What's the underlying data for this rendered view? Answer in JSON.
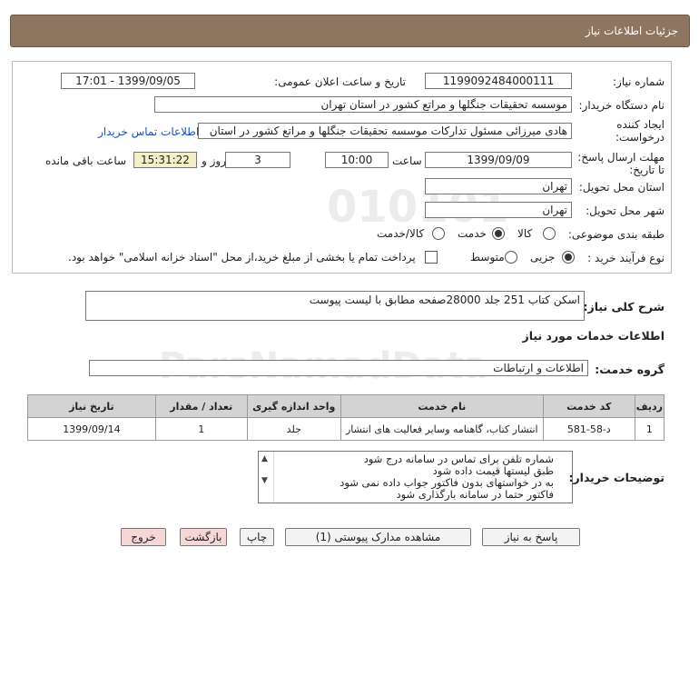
{
  "header": {
    "title": "جزئیات اطلاعات نیاز"
  },
  "need": {
    "number_label": "شماره نیاز:",
    "number_value": "1199092484000111",
    "announce_label": "تاریخ و ساعت اعلان عمومی:",
    "announce_value": "1399/09/05 - 17:01",
    "buyer_label": "نام دستگاه خریدار:",
    "buyer_value": "موسسه تحقیقات جنگلها و مراتع کشور در استان تهران",
    "creator_label": "ایجاد کننده درخواست:",
    "creator_value": "هادی میرزائی مسئول تدارکات موسسه تحقیقات جنگلها و مراتع کشور در استان",
    "contact_link": "اطلاعات تماس خریدار",
    "deadline_label": "مهلت ارسال پاسخ: تا تاریخ:",
    "deadline_date": "1399/09/09",
    "time_label": "ساعت",
    "deadline_time": "10:00",
    "days_value": "3",
    "days_label": "روز و",
    "remaining_time": "15:31:22",
    "remaining_label": "ساعت باقی مانده",
    "province_label": "استان محل تحویل:",
    "province_value": "تهران",
    "city_label": "شهر محل تحویل:",
    "city_value": "تهران",
    "category_label": "طبقه بندی موضوعی:",
    "category_options": [
      "کالا",
      "خدمت",
      "کالا/خدمت"
    ],
    "process_label": "نوع فرآیند خرید :",
    "process_options": [
      "جزیی",
      "متوسط"
    ],
    "payment_note": "پرداخت تمام یا بخشی از مبلغ خرید،از محل \"اسناد خزانه اسلامی\" خواهد بود."
  },
  "summary": {
    "label": "شرح کلی نیاز:",
    "value": "اسکن کتاب 251 جلد 28000صفحه مطابق با لیست پیوست"
  },
  "services_heading": "اطلاعات خدمات مورد نیاز",
  "service_group": {
    "label": "گروه خدمت:",
    "value": "اطلاعات و ارتباطات"
  },
  "table": {
    "headers": [
      "ردیف",
      "کد خدمت",
      "نام خدمت",
      "واحد اندازه گیری",
      "تعداد / مقدار",
      "تاریخ نیاز"
    ],
    "rows": [
      [
        "1",
        "د-58-581",
        "انتشار کتاب، گاهنامه وسایر فعالیت های انتشار",
        "جلد",
        "1",
        "1399/09/14"
      ]
    ]
  },
  "buyer_notes": {
    "label": "توضیحات خریدار:",
    "lines": [
      "شماره تلفن برای تماس در سامانه درج شود",
      "طبق لیستها قیمت داده شود",
      "به در خواستهای بدون فاکتور جواب داده نمی شود",
      "فاکتور حتما در سامانه بارگذاری شود"
    ]
  },
  "buttons": {
    "respond": "پاسخ به نیاز",
    "attachments": "مشاهده مدارک پیوستی (1)",
    "print": "چاپ",
    "back": "بازگشت",
    "exit": "خروج"
  },
  "colors": {
    "header_bg": "#8d7560",
    "remaining_bg": "#f3f0c8",
    "link": "#1a4fb5"
  }
}
